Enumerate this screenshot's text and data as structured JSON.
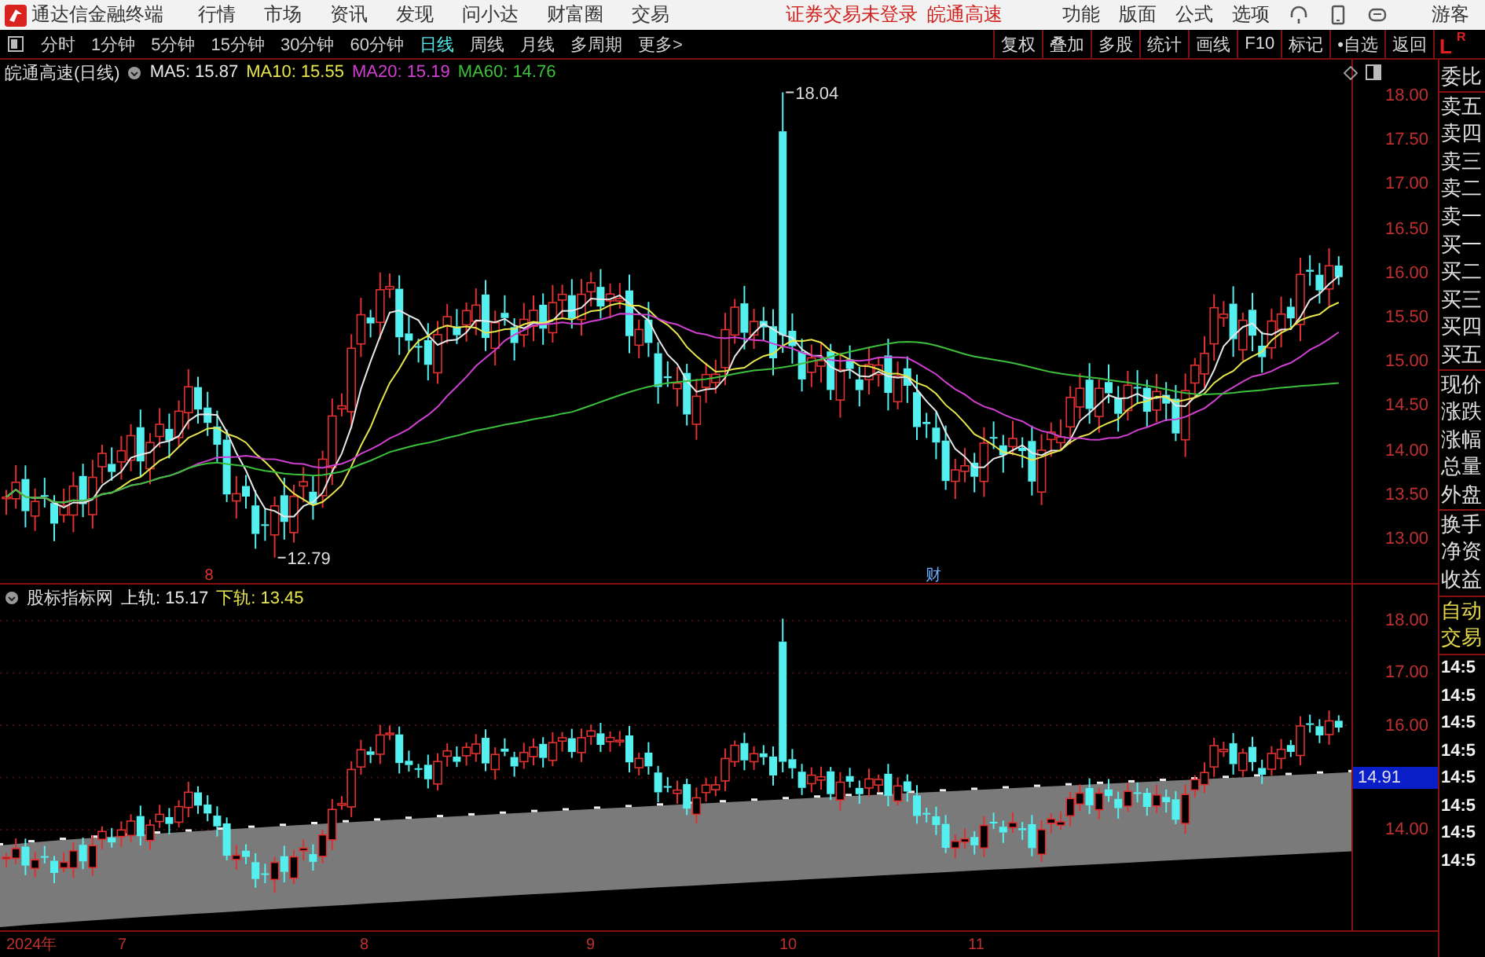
{
  "menubar": {
    "app_title": "通达信金融终端",
    "menus": [
      "行情",
      "市场",
      "资讯",
      "发现",
      "问小达",
      "财富圈",
      "交易"
    ],
    "notice": "证券交易未登录",
    "stock_name": "皖通高速",
    "tools": [
      "功能",
      "版面",
      "公式",
      "选项"
    ],
    "user": "游客"
  },
  "toolbar": {
    "periods": [
      {
        "label": "分时",
        "selected": false
      },
      {
        "label": "1分钟",
        "selected": false
      },
      {
        "label": "5分钟",
        "selected": false
      },
      {
        "label": "15分钟",
        "selected": false
      },
      {
        "label": "30分钟",
        "selected": false
      },
      {
        "label": "60分钟",
        "selected": false
      },
      {
        "label": "日线",
        "selected": true
      },
      {
        "label": "周线",
        "selected": false
      },
      {
        "label": "月线",
        "selected": false
      },
      {
        "label": "多周期",
        "selected": false
      },
      {
        "label": "更多>",
        "selected": false
      }
    ],
    "buttons": [
      "复权",
      "叠加",
      "多股",
      "统计",
      "画线",
      "F10",
      "标记",
      "•自选",
      "返回"
    ],
    "corner_left": "L",
    "corner_right": "R"
  },
  "main_chart": {
    "title": "皖通高速(日线)",
    "indicators": [
      {
        "label": "MA5: 15.87",
        "color": "#e8e8e8"
      },
      {
        "label": "MA10: 15.55",
        "color": "#e6e64c"
      },
      {
        "label": "MA20: 15.19",
        "color": "#d040d0"
      },
      {
        "label": "MA60: 14.76",
        "color": "#3cc03c"
      }
    ],
    "high_label": "18.04",
    "low_label": "12.79",
    "event_marks": [
      "8",
      "财"
    ],
    "y_ticks": [
      "18.00",
      "17.50",
      "17.00",
      "16.50",
      "16.00",
      "15.50",
      "15.00",
      "14.50",
      "14.00",
      "13.50",
      "13.00"
    ]
  },
  "sub_chart": {
    "title": "股标指标网",
    "lines": [
      {
        "label": "上轨: 15.17",
        "color": "#e8e8e8"
      },
      {
        "label": "下轨: 13.45",
        "color": "#e6e64c"
      }
    ],
    "y_ticks": [
      "18.00",
      "17.00",
      "16.00",
      "14.91",
      "14.00"
    ]
  },
  "quote_panel": {
    "groups": [
      [
        "委比"
      ],
      [
        "卖五",
        "卖四",
        "卖三",
        "卖二",
        "卖一",
        "买一",
        "买二",
        "买三",
        "买四",
        "买五"
      ],
      [
        "现价",
        "涨跌",
        "涨幅",
        "总量",
        "外盘"
      ],
      [
        "换手",
        "净资",
        "收益"
      ]
    ]
  },
  "trade_panel": {
    "title": [
      "自动",
      "交易"
    ],
    "times": [
      "14:5",
      "14:5",
      "14:5",
      "14:5",
      "14:5",
      "14:5",
      "14:5",
      "14:5"
    ]
  },
  "date_axis": [
    "2024年",
    "7",
    "8",
    "9",
    "10",
    "11"
  ]
}
